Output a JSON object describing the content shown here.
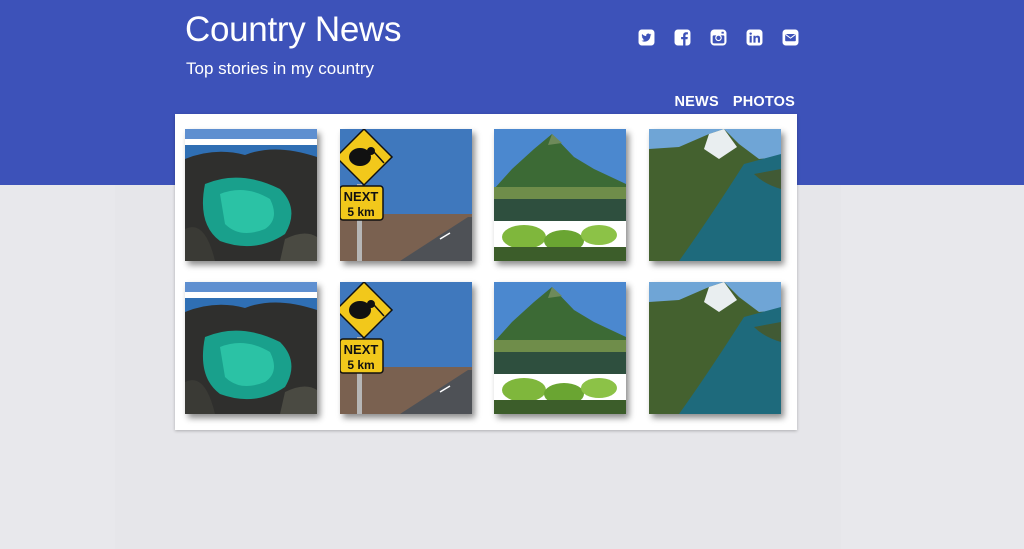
{
  "site": {
    "title": "Country News",
    "subtitle": "Top stories in my country"
  },
  "colors": {
    "header": "#3d52b9",
    "page_background": "#e8e8ec",
    "card": "#ffffff"
  },
  "social": [
    {
      "name": "twitter-icon"
    },
    {
      "name": "facebook-icon"
    },
    {
      "name": "instagram-icon"
    },
    {
      "name": "linkedin-icon"
    },
    {
      "name": "email-icon"
    }
  ],
  "nav": {
    "news": "NEWS",
    "photos": "PHOTOS"
  },
  "sign": {
    "line1": "NEXT",
    "line2": "5 km"
  },
  "gallery": {
    "rows": 2,
    "images": [
      "coastal-rock-pool",
      "kiwi-road-sign",
      "mountain-lake",
      "fjord-aerial",
      "coastal-rock-pool",
      "kiwi-road-sign",
      "mountain-lake",
      "fjord-aerial"
    ]
  }
}
